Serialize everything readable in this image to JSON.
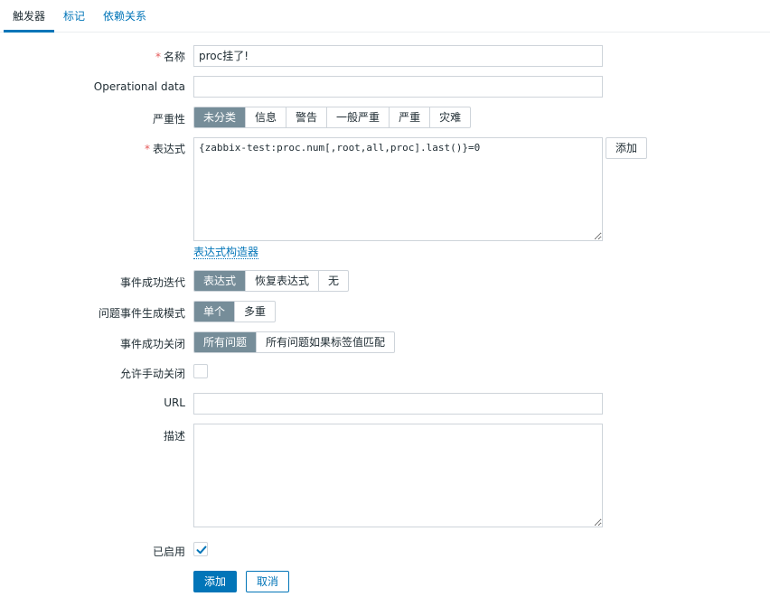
{
  "tabs": [
    {
      "label": "触发器",
      "active": true
    },
    {
      "label": "标记",
      "active": false
    },
    {
      "label": "依赖关系",
      "active": false
    }
  ],
  "form": {
    "name": {
      "label": "名称",
      "required": true,
      "value": "proc挂了!"
    },
    "operational_data": {
      "label": "Operational data",
      "value": ""
    },
    "severity": {
      "label": "严重性",
      "options": [
        "未分类",
        "信息",
        "警告",
        "一般严重",
        "严重",
        "灾难"
      ],
      "selected": "未分类"
    },
    "expression": {
      "label": "表达式",
      "required": true,
      "value": "{zabbix-test:proc.num[,root,all,proc].last()}=0",
      "add_button": "添加",
      "constructor_link": "表达式构造器"
    },
    "ok_event_generation": {
      "label": "事件成功迭代",
      "options": [
        "表达式",
        "恢复表达式",
        "无"
      ],
      "selected": "表达式"
    },
    "problem_event_mode": {
      "label": "问题事件生成模式",
      "options": [
        "单个",
        "多重"
      ],
      "selected": "单个"
    },
    "ok_event_closes": {
      "label": "事件成功关闭",
      "options": [
        "所有问题",
        "所有问题如果标签值匹配"
      ],
      "selected": "所有问题"
    },
    "manual_close": {
      "label": "允许手动关闭",
      "checked": false
    },
    "url": {
      "label": "URL",
      "value": ""
    },
    "description": {
      "label": "描述",
      "value": ""
    },
    "enabled": {
      "label": "已启用",
      "checked": true
    },
    "actions": {
      "submit": "添加",
      "cancel": "取消"
    }
  },
  "colors": {
    "accent": "#0275b8",
    "selected_segment": "#768d99",
    "required": "#e45959"
  }
}
